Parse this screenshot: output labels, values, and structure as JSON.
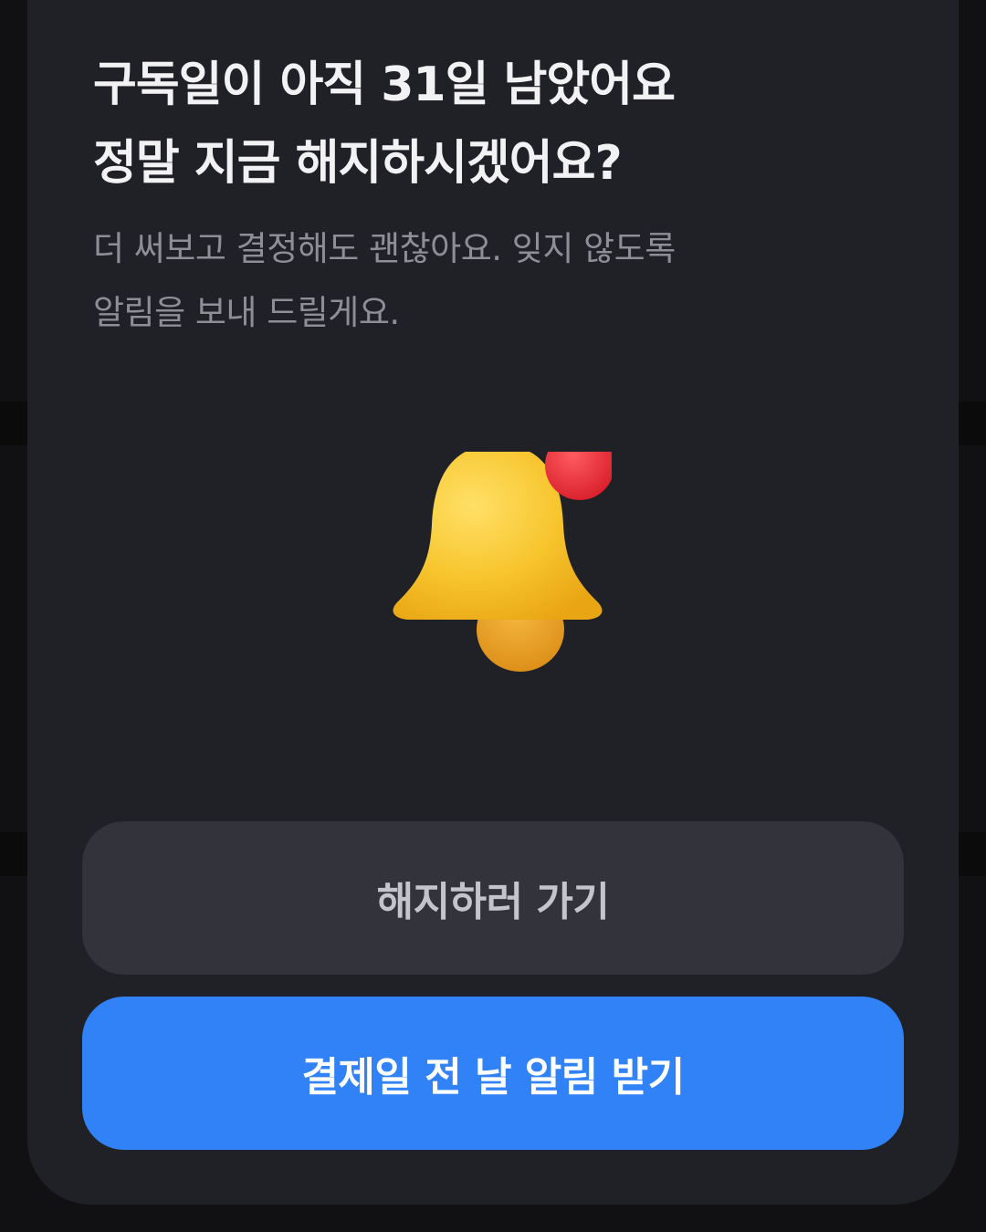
{
  "dialog": {
    "title_lines": [
      "구독일이 아직 31일 남았어요",
      "정말 지금 해지하시겠어요?"
    ],
    "subtitle_lines": [
      "더 써보고 결정해도 괜찮아요. 잊지 않도록",
      "알림을 보내 드릴게요."
    ],
    "icon": "bell-notification-icon",
    "cancel_button_label": "해지하러 가기",
    "remind_button_label": "결제일 전 날 알림 받기"
  },
  "colors": {
    "background": "#202027",
    "cancel_button": "#33333c",
    "primary_button": "#3182f6",
    "bell": "#f7c52e",
    "notification_dot": "#e8323c"
  }
}
